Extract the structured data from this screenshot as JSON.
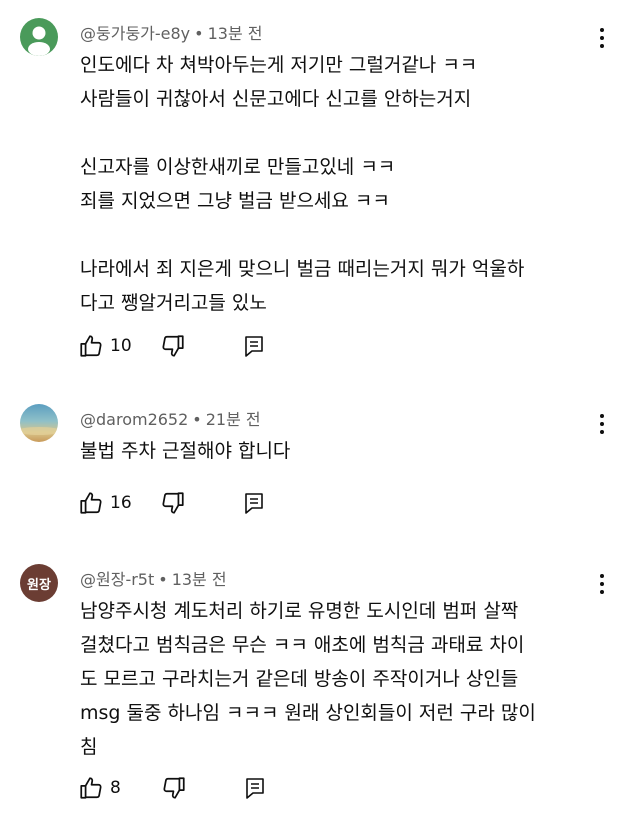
{
  "comments": [
    {
      "avatar": "default-person-icon",
      "author": "@둥가둥가-e8y",
      "time": "13분 전",
      "text": "인도에다 차 쳐박아두는게 저기만 그럴거같나 ㅋㅋ\n사람들이 귀찮아서 신문고에다 신고를 안하는거지\n\n신고자를 이상한새끼로 만들고있네 ㅋㅋ\n죄를 지었으면 그냥 벌금 받으세요 ㅋㅋ\n\n나라에서 죄 지은게 맞으니 벌금 때리는거지 뭐가 억울하\n다고 쨍알거리고들 있노",
      "likes": "10"
    },
    {
      "avatar": "landscape-photo-avatar",
      "author": "@darom2652",
      "time": "21분 전",
      "text": "불법 주차 근절해야 합니다",
      "likes": "16"
    },
    {
      "avatar_text": "원장",
      "author": "@원장-r5t",
      "time": "13분 전",
      "text": "남양주시청 계도처리 하기로 유명한 도시인데 범퍼 살짝\n걸쳤다고 범칙금은 무슨 ㅋㅋ 애초에 범칙금 과태료 차이\n도 모르고 구라치는거 같은데 방송이 주작이거나 상인들\nmsg 둘중 하나임 ㅋㅋㅋ 원래 상인회들이 저런 구라 많이\n침",
      "likes": "8"
    }
  ],
  "separator": "•",
  "icons": {
    "like": "thumb-up-icon",
    "dislike": "thumb-down-icon",
    "reply": "reply-icon",
    "more": "more-vert-icon"
  },
  "colors": {
    "meta_text": "#606060",
    "text": "#0f0f0f"
  }
}
